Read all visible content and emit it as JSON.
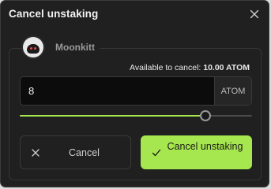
{
  "dialog": {
    "title": "Cancel unstaking",
    "close_icon": "close-icon"
  },
  "validator": {
    "name": "Moonkitt",
    "avatar_icon": "cat-avatar"
  },
  "available": {
    "label": "Available to cancel:",
    "value": "10.00 ATOM"
  },
  "amount": {
    "value": "8",
    "unit": "ATOM"
  },
  "slider": {
    "fraction": 0.8
  },
  "actions": {
    "cancel_label": "Cancel",
    "cancel_icon": "close-icon",
    "confirm_label": "Cancel unstaking",
    "confirm_icon": "check-icon"
  },
  "colors": {
    "accent": "#a6e64e",
    "background": "#202020",
    "input_background": "#0c0c0c"
  }
}
